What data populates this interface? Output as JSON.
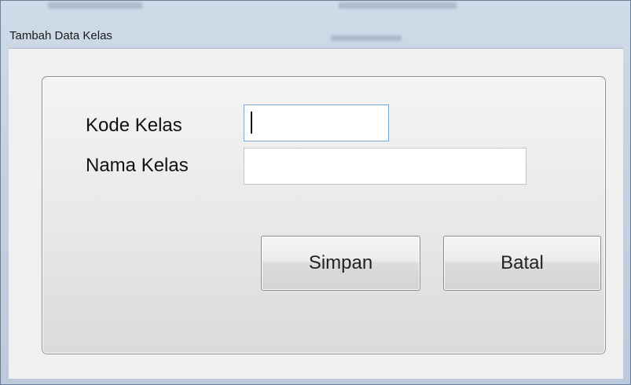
{
  "window": {
    "title": "Tambah Data Kelas"
  },
  "form": {
    "kode_kelas_label": "Kode Kelas",
    "kode_kelas_value": "",
    "nama_kelas_label": "Nama Kelas",
    "nama_kelas_value": ""
  },
  "buttons": {
    "simpan_label": "Simpan",
    "batal_label": "Batal"
  }
}
